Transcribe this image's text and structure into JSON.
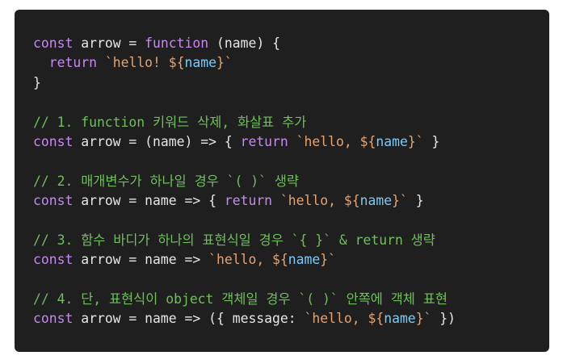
{
  "colors": {
    "panel_background": "#1f1f1f",
    "page_background": "#ffffff",
    "keyword": "#c589f0",
    "string": "#e5a46f",
    "interpolated_variable": "#7ccaf8",
    "plain_text": "#e6e6e6",
    "comment": "#6fbf5b"
  },
  "code": {
    "lines": [
      [
        {
          "t": "const",
          "c": "kw"
        },
        {
          "t": " ",
          "c": "id"
        },
        {
          "t": "arrow",
          "c": "id"
        },
        {
          "t": " = ",
          "c": "id"
        },
        {
          "t": "function",
          "c": "kw"
        },
        {
          "t": " (name) {",
          "c": "id"
        }
      ],
      [
        {
          "t": "  ",
          "c": "id"
        },
        {
          "t": "return",
          "c": "kw"
        },
        {
          "t": " ",
          "c": "id"
        },
        {
          "t": "`hello! ${",
          "c": "str"
        },
        {
          "t": "name",
          "c": "var"
        },
        {
          "t": "}`",
          "c": "str"
        }
      ],
      [
        {
          "t": "}",
          "c": "id"
        }
      ],
      [],
      [
        {
          "t": "// 1. function 키워드 삭제, 화살표 추가",
          "c": "cm"
        }
      ],
      [
        {
          "t": "const",
          "c": "kw"
        },
        {
          "t": " arrow = (name) => { ",
          "c": "id"
        },
        {
          "t": "return",
          "c": "kw"
        },
        {
          "t": " ",
          "c": "id"
        },
        {
          "t": "`hello, ${",
          "c": "str"
        },
        {
          "t": "name",
          "c": "var"
        },
        {
          "t": "}`",
          "c": "str"
        },
        {
          "t": " }",
          "c": "id"
        }
      ],
      [],
      [
        {
          "t": "// 2. 매개변수가 하나일 경우 `( )` 생략",
          "c": "cm"
        }
      ],
      [
        {
          "t": "const",
          "c": "kw"
        },
        {
          "t": " arrow = name => { ",
          "c": "id"
        },
        {
          "t": "return",
          "c": "kw"
        },
        {
          "t": " ",
          "c": "id"
        },
        {
          "t": "`hello, ${",
          "c": "str"
        },
        {
          "t": "name",
          "c": "var"
        },
        {
          "t": "}`",
          "c": "str"
        },
        {
          "t": " }",
          "c": "id"
        }
      ],
      [],
      [
        {
          "t": "// 3. 함수 바디가 하나의 표현식일 경우 `{ }` & return 생략",
          "c": "cm"
        }
      ],
      [
        {
          "t": "const",
          "c": "kw"
        },
        {
          "t": " arrow = name => ",
          "c": "id"
        },
        {
          "t": "`hello, ${",
          "c": "str"
        },
        {
          "t": "name",
          "c": "var"
        },
        {
          "t": "}`",
          "c": "str"
        }
      ],
      [],
      [
        {
          "t": "// 4. 단, 표현식이 object 객체일 경우 `( )` 안쪽에 객체 표현",
          "c": "cm"
        }
      ],
      [
        {
          "t": "const",
          "c": "kw"
        },
        {
          "t": " arrow = name => ({ message: ",
          "c": "id"
        },
        {
          "t": "`hello, ${",
          "c": "str"
        },
        {
          "t": "name",
          "c": "var"
        },
        {
          "t": "}`",
          "c": "str"
        },
        {
          "t": " })",
          "c": "id"
        }
      ]
    ]
  }
}
